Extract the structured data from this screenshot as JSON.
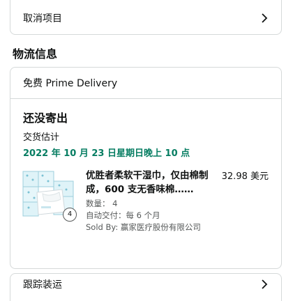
{
  "cancel": {
    "label": "取消项目"
  },
  "shipping_section": {
    "heading": "物流信息"
  },
  "shipment": {
    "delivery_option": "免费 Prime Delivery",
    "status": "还没寄出",
    "estimate_label": "交货估计",
    "estimate_date": "2022 年 10 月 23 日星期日晚上 10 点",
    "item": {
      "title": "优胜者柔软干湿巾，仅由棉制成，600 支无香味棉……",
      "price": "32.98 美元",
      "quantity_badge": "4",
      "quantity": "数量： 4",
      "subscription": "自动交付：每 6 个月",
      "seller": "Sold By: 赢家医疗股份有限公司",
      "image_icon": "wipes-product-image"
    }
  },
  "track": {
    "label": "跟踪装运"
  },
  "colors": {
    "accent_green": "#067d62",
    "border": "#d5d9d9",
    "text": "#0f1111",
    "muted": "#565959"
  }
}
